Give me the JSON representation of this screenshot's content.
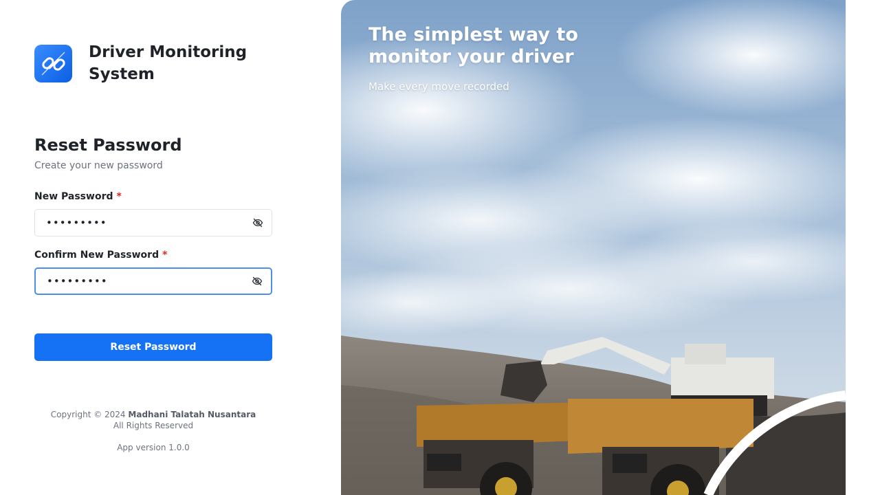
{
  "brand": {
    "name": "Driver Monitoring System",
    "logo_icon": "chain-link-icon"
  },
  "form": {
    "title": "Reset Password",
    "subtitle": "Create your new password",
    "new_password": {
      "label": "New Password",
      "required_mark": "*",
      "value": "•••••••••",
      "toggle_icon": "eye-slash-icon"
    },
    "confirm_password": {
      "label": "Confirm New Password",
      "required_mark": "*",
      "value": "•••••••••",
      "toggle_icon": "eye-slash-icon"
    },
    "submit_label": "Reset Password"
  },
  "footer": {
    "copyright_prefix": "Copyright © 2024",
    "company": "Madhani Talatah Nusantara",
    "rights": "All Rights Reserved",
    "version": "App version 1.0.0"
  },
  "hero": {
    "title": "The simplest way to monitor your driver",
    "subtitle": "Make every move recorded"
  },
  "colors": {
    "primary": "#1672F5",
    "required": "#E02424",
    "focus_border": "#4C8EE0"
  }
}
